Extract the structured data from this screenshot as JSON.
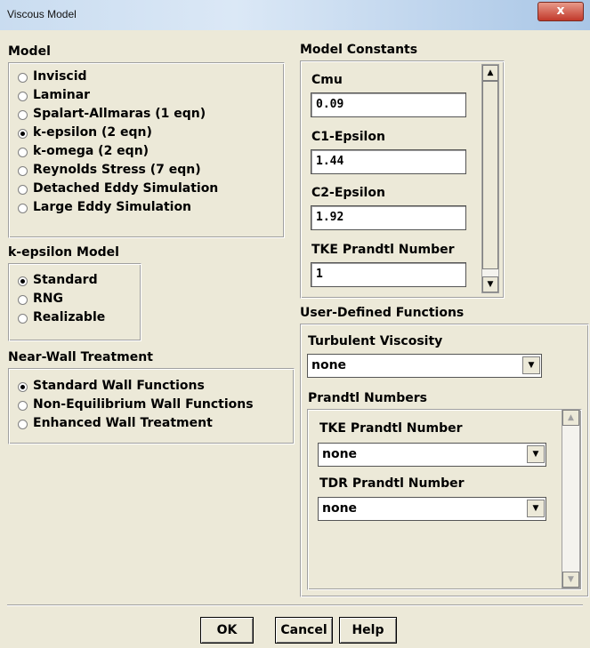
{
  "window": {
    "title": "Viscous Model",
    "close_glyph": "x"
  },
  "model": {
    "label": "Model",
    "options": [
      {
        "label": "Inviscid",
        "selected": false
      },
      {
        "label": "Laminar",
        "selected": false
      },
      {
        "label": "Spalart-Allmaras  (1 eqn)",
        "selected": false
      },
      {
        "label": "k-epsilon  (2 eqn)",
        "selected": true
      },
      {
        "label": "k-omega  (2 eqn)",
        "selected": false
      },
      {
        "label": "Reynolds Stress  (7 eqn)",
        "selected": false
      },
      {
        "label": "Detached Eddy Simulation",
        "selected": false
      },
      {
        "label": "Large Eddy Simulation",
        "selected": false
      }
    ]
  },
  "kepsilon": {
    "label": "k-epsilon Model",
    "options": [
      {
        "label": "Standard",
        "selected": true
      },
      {
        "label": "RNG",
        "selected": false
      },
      {
        "label": "Realizable",
        "selected": false
      }
    ]
  },
  "nearwall": {
    "label": "Near-Wall Treatment",
    "options": [
      {
        "label": "Standard Wall Functions",
        "selected": true
      },
      {
        "label": "Non-Equilibrium Wall Functions",
        "selected": false
      },
      {
        "label": "Enhanced Wall Treatment",
        "selected": false
      }
    ]
  },
  "constants": {
    "label": "Model Constants",
    "fields": [
      {
        "label": "Cmu",
        "value": "0.09"
      },
      {
        "label": "C1-Epsilon",
        "value": "1.44"
      },
      {
        "label": "C2-Epsilon",
        "value": "1.92"
      },
      {
        "label": "TKE Prandtl Number",
        "value": "1"
      }
    ]
  },
  "udf": {
    "label": "User-Defined Functions",
    "turbulent_viscosity_label": "Turbulent Viscosity",
    "turbulent_viscosity_value": "none",
    "prandtl_label": "Prandtl Numbers",
    "tke_label": "TKE Prandtl Number",
    "tke_value": "none",
    "tdr_label": "TDR Prandtl Number",
    "tdr_value": "none"
  },
  "buttons": {
    "ok": "OK",
    "cancel": "Cancel",
    "help": "Help"
  },
  "icons": {
    "arrow_up": "▲",
    "arrow_down": "▼"
  }
}
